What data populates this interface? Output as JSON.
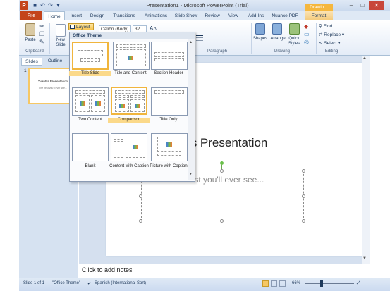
{
  "window": {
    "title": "Presentation1 - Microsoft PowerPoint (Trial)",
    "app_icon": "P",
    "minimize": "–",
    "maximize": "□",
    "close": "✕"
  },
  "quick_access": [
    "save-icon",
    "undo-icon",
    "redo-icon",
    "customize-icon"
  ],
  "tabs": {
    "file": "File",
    "items": [
      "Home",
      "Insert",
      "Design",
      "Transitions",
      "Animations",
      "Slide Show",
      "Review",
      "View",
      "Add-Ins",
      "Nuance PDF",
      "Format"
    ],
    "contextual": "Drawin..."
  },
  "ribbon": {
    "clipboard": {
      "paste": "Paste",
      "group": "Clipboard"
    },
    "slides": {
      "new_slide": "New Slide",
      "layout": "Layout"
    },
    "font": {
      "name": "Calibri (Body)",
      "size": "32"
    },
    "paragraph": {
      "group": "Paragraph"
    },
    "drawing": {
      "shapes": "Shapes",
      "arrange": "Arrange",
      "quick_styles": "Quick Styles",
      "group": "Drawing"
    },
    "editing": {
      "find": "Find",
      "replace": "Replace",
      "select": "Select",
      "group": "Editing"
    }
  },
  "left_pane": {
    "tab_slides": "Slides",
    "tab_outline": "Outline",
    "close": "×",
    "slide_number": "1",
    "thumb_title": "Yvanh's Presentation",
    "thumb_sub": "The best you'll ever see..."
  },
  "layout_menu": {
    "header": "Office Theme",
    "items": [
      {
        "label": "Title Slide",
        "selected": true
      },
      {
        "label": "Title and Content",
        "selected": false
      },
      {
        "label": "Section Header",
        "selected": false
      },
      {
        "label": "Two Content",
        "selected": false
      },
      {
        "label": "Comparison",
        "selected": true
      },
      {
        "label": "Title Only",
        "selected": false
      },
      {
        "label": "Blank",
        "selected": false
      },
      {
        "label": "Content with Caption",
        "selected": false
      },
      {
        "label": "Picture with Caption",
        "selected": false
      }
    ]
  },
  "slide": {
    "title": "h's Presentation",
    "subtitle": "The best you'll ever see..."
  },
  "notes": {
    "placeholder": "Click to add notes"
  },
  "status": {
    "slide": "Slide 1 of 1",
    "theme": "\"Office Theme\"",
    "language": "Spanish (International Sort)",
    "zoom": "66%"
  },
  "colors": {
    "file_tab": "#c4441c",
    "accent": "#f6c764",
    "ribbon": "#dfe9f5"
  }
}
